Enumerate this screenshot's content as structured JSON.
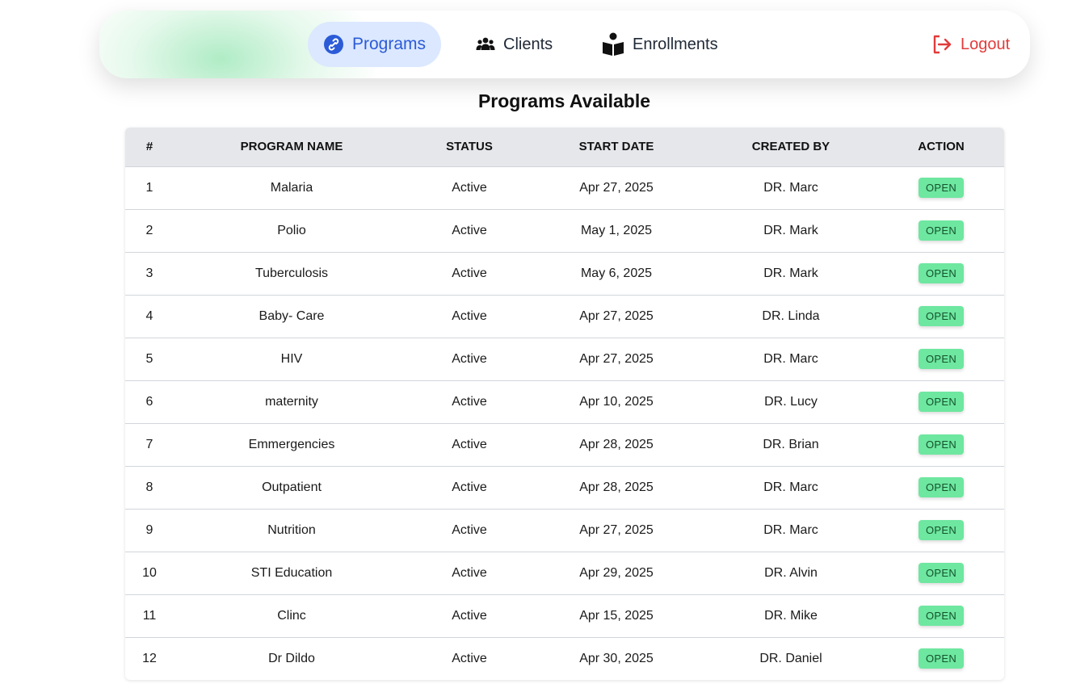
{
  "nav": {
    "programs_label": "Programs",
    "clients_label": "Clients",
    "enrollments_label": "Enrollments",
    "logout_label": "Logout",
    "active_color": "#2b5bd7",
    "logout_color": "#e23b3b"
  },
  "page_title": "Programs Available",
  "table": {
    "headers": [
      "#",
      "PROGRAM NAME",
      "STATUS",
      "START DATE",
      "CREATED BY",
      "ACTION"
    ],
    "rows": [
      {
        "num": "1",
        "name": "Malaria",
        "status": "Active",
        "start": "Apr 27, 2025",
        "by": "DR. Marc",
        "action": "OPEN"
      },
      {
        "num": "2",
        "name": "Polio",
        "status": "Active",
        "start": "May 1, 2025",
        "by": "DR. Mark",
        "action": "OPEN"
      },
      {
        "num": "3",
        "name": "Tuberculosis",
        "status": "Active",
        "start": "May 6, 2025",
        "by": "DR. Mark",
        "action": "OPEN"
      },
      {
        "num": "4",
        "name": "Baby- Care",
        "status": "Active",
        "start": "Apr 27, 2025",
        "by": "DR. Linda",
        "action": "OPEN"
      },
      {
        "num": "5",
        "name": "HIV",
        "status": "Active",
        "start": "Apr 27, 2025",
        "by": "DR. Marc",
        "action": "OPEN"
      },
      {
        "num": "6",
        "name": "maternity",
        "status": "Active",
        "start": "Apr 10, 2025",
        "by": "DR. Lucy",
        "action": "OPEN"
      },
      {
        "num": "7",
        "name": "Emmergencies",
        "status": "Active",
        "start": "Apr 28, 2025",
        "by": "DR. Brian",
        "action": "OPEN"
      },
      {
        "num": "8",
        "name": "Outpatient",
        "status": "Active",
        "start": "Apr 28, 2025",
        "by": "DR. Marc",
        "action": "OPEN"
      },
      {
        "num": "9",
        "name": "Nutrition",
        "status": "Active",
        "start": "Apr 27, 2025",
        "by": "DR. Marc",
        "action": "OPEN"
      },
      {
        "num": "10",
        "name": "STI Education",
        "status": "Active",
        "start": "Apr 29, 2025",
        "by": "DR. Alvin",
        "action": "OPEN"
      },
      {
        "num": "11",
        "name": "Clinc",
        "status": "Active",
        "start": "Apr 15, 2025",
        "by": "DR. Mike",
        "action": "OPEN"
      },
      {
        "num": "12",
        "name": "Dr Dildo",
        "status": "Active",
        "start": "Apr 30, 2025",
        "by": "DR. Daniel",
        "action": "OPEN"
      }
    ]
  },
  "icons": {
    "programs": "link-icon",
    "clients": "users-icon",
    "enrollments": "reader-icon",
    "logout": "logout-icon"
  }
}
